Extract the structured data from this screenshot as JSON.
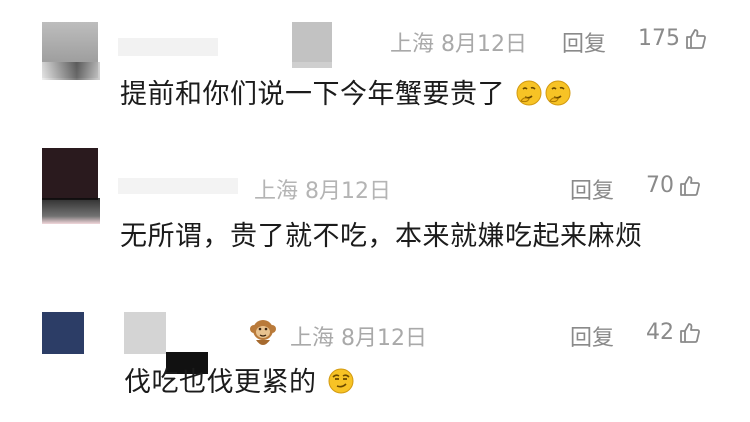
{
  "comments": [
    {
      "location_date": "上海 8月12日",
      "reply_label": "回复",
      "likes": "175",
      "text": "提前和你们说一下今年蟹要贵了",
      "emoji": [
        "thinking-face-emoji",
        "thinking-face-emoji"
      ]
    },
    {
      "location_date": "上海 8月12日",
      "reply_label": "回复",
      "likes": "70",
      "text": "无所谓，贵了就不吃，本来就嫌吃起来麻烦",
      "emoji": []
    },
    {
      "location_date": "上海 8月12日",
      "reply_label": "回复",
      "likes": "42",
      "text": "伐吃也伐更紧的",
      "badge": "monkey-icon",
      "emoji": [
        "smirk-face-emoji"
      ]
    }
  ]
}
